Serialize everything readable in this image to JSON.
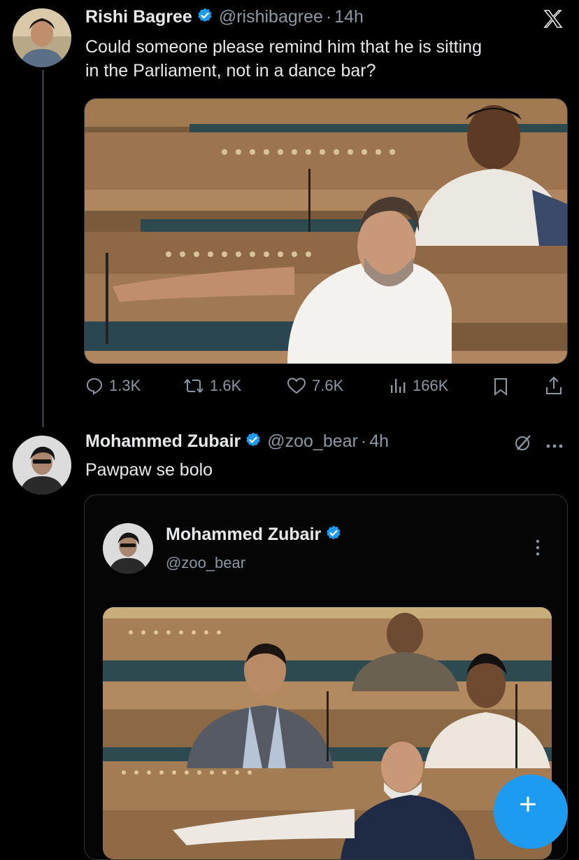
{
  "tweet1": {
    "name": "Rishi Bagree",
    "handle": "@rishibagree",
    "dot": "·",
    "time": "14h",
    "text_line1": "Could someone please remind him that he is sitting",
    "text_line2": "in the Parliament, not in a dance bar?",
    "platform_icon": "x-logo-icon",
    "actions": {
      "replies": "1.3K",
      "reposts": "1.6K",
      "likes": "7.6K",
      "views": "166K"
    }
  },
  "tweet2": {
    "name": "Mohammed Zubair",
    "handle": "@zoo_bear",
    "dot": "·",
    "time": "4h",
    "text": "Pawpaw se bolo",
    "grok_icon": "grok-icon",
    "more_icon": "more-horizontal-icon"
  },
  "quote": {
    "name": "Mohammed Zubair",
    "handle": "@zoo_bear",
    "more_icon": "more-vertical-icon"
  },
  "fab": {
    "label": "+"
  },
  "colors": {
    "background": "#000000",
    "text": "#e7e9ea",
    "secondary": "#8b98a5",
    "accent": "#1d9bf0",
    "border": "#2f3336"
  }
}
